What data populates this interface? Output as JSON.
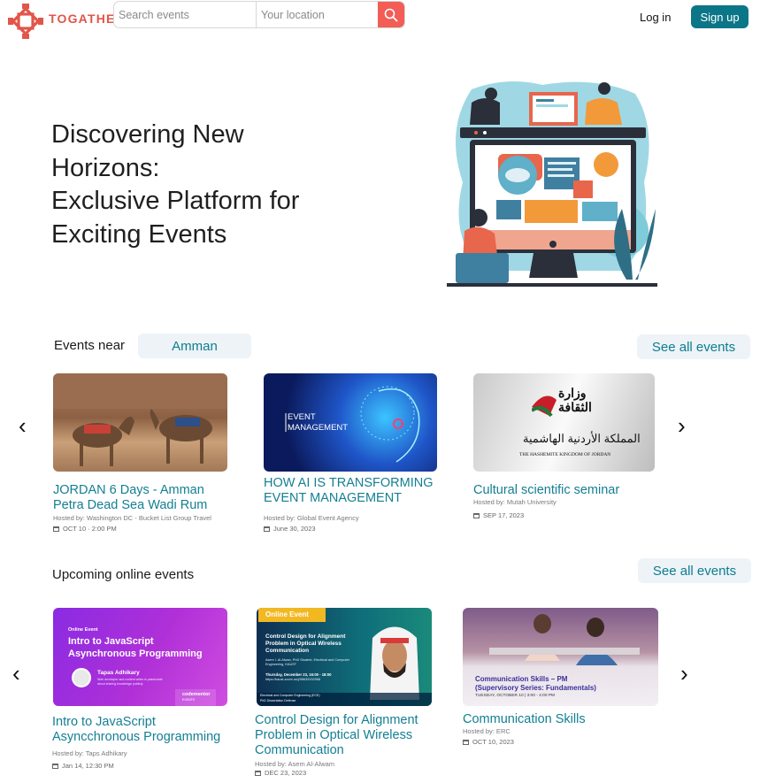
{
  "header": {
    "brand": "TOGATHER",
    "search_placeholder": "Search events",
    "location_placeholder": "Your location",
    "login_label": "Log in",
    "signup_label": "Sign up",
    "accent": "#e2554a",
    "primary": "#0b7687"
  },
  "hero": {
    "title_lines": [
      "Discovering New",
      "Horizons:",
      "Exclusive Platform for",
      "Exciting Events"
    ]
  },
  "nearby": {
    "label": "Events near",
    "city": "Amman",
    "see_all_label": "See all events",
    "cards": [
      {
        "title": "JORDAN 6 Days - Amman Petra Dead Sea Wadi Rum",
        "host": "Hosted by: Washington DC - Bucket List Group Travel",
        "date": "OCT 10 · 2:00 PM"
      },
      {
        "title": "HOW AI IS TRANSFORMING EVENT MANAGEMENT",
        "host": "Hosted by: Global Event Agency",
        "date": "June 30, 2023",
        "image_text": [
          "EVENT",
          "MANAGEMENT"
        ]
      },
      {
        "title": "Cultural scientific seminar",
        "host": "Hosted by: Mutah University",
        "date": "SEP 17, 2023",
        "image_text": [
          "وزارة",
          "الثقافة",
          "المملكة الأردنية الهاشمية",
          "THE HASHEMITE KINGDOM OF JORDAN"
        ]
      }
    ]
  },
  "online": {
    "label": "Upcoming online events",
    "see_all_label": "See all events",
    "cards": [
      {
        "title": "Intro to JavaScript Asyncchronous Programming",
        "host": "Hosted by: Taps Adhikary",
        "date": "Jan 14, 12:30 PM",
        "image_text": {
          "tag": "Online Event",
          "headline": "Intro to JavaScript Asynchronous Programming",
          "speaker": "Tapas Adhikary",
          "speaker_bio": "Web developer and content writer is passionate about sharing knowledge publicly",
          "brand": "codementor",
          "brand_sub": "EVENTS"
        }
      },
      {
        "title": "Control Design for Alignment Problem in Optical Wireless Communication",
        "host": "Hosted by: Asem Al-Alwam",
        "date": "DEC 23, 2023",
        "image_text": {
          "tag": "Online Event",
          "headline": "Control Design for Alignment Problem in Optical Wireless Communication",
          "presenter": "Asem I. Al-Alwan, PhD Student, Electrical and Computer Engineering, KAUST",
          "when": "Thursday, December 23, 16:00 - 18:00",
          "link": "https://kaust.zoom.us/j/98639292968",
          "footer1": "Electrical and Computer Engineering (ECE)",
          "footer2": "PhD Dissertation Defense"
        }
      },
      {
        "title": "Communication Skills",
        "host": "Hosted by: ERC",
        "date": "OCT 10, 2023",
        "image_text": {
          "headline1": "Communication Skills – PM",
          "headline2": "(Supervisory Series: Fundamentals)",
          "when": "TUESDAY, OCTOBER 10  |  3:00 - 4:00 PM"
        }
      }
    ]
  }
}
